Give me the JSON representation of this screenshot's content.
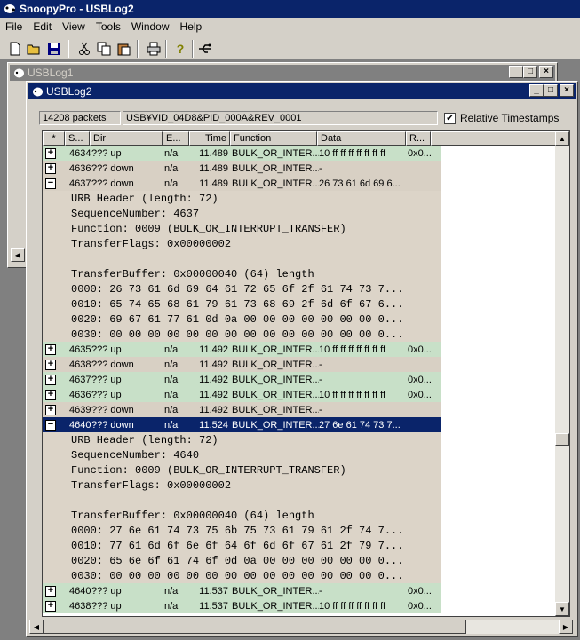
{
  "app": {
    "title": "SnoopyPro - USBLog2"
  },
  "menu": [
    "File",
    "Edit",
    "View",
    "Tools",
    "Window",
    "Help"
  ],
  "toolbar_icons": [
    "new-icon",
    "open-icon",
    "save-icon",
    "cut-icon",
    "copy-icon",
    "paste-icon",
    "print-icon",
    "help-icon",
    "usb-icon"
  ],
  "windows": {
    "back": {
      "title": "USBLog1"
    },
    "front": {
      "title": "USBLog2"
    }
  },
  "info": {
    "packets": "14208 packets",
    "device": "USB¥VID_04D8&PID_000A&REV_0001",
    "relative_label": "Relative Timestamps",
    "relative_checked": true
  },
  "columns": [
    "*",
    "S...",
    "Dir",
    "E...",
    "Time",
    "Function",
    "Data",
    "R..."
  ],
  "rows": [
    {
      "kind": "packet",
      "style": "g",
      "exp": "+",
      "s": "4634",
      "dir": "??? up",
      "e": "n/a",
      "time": "11.489",
      "func": "BULK_OR_INTER...",
      "data": "10 ff ff ff ff ff ff ff",
      "r": "0x0..."
    },
    {
      "kind": "packet",
      "style": "t",
      "exp": "+",
      "s": "4636",
      "dir": "??? down",
      "e": "n/a",
      "time": "11.489",
      "func": "BULK_OR_INTER...",
      "data": "-",
      "r": ""
    },
    {
      "kind": "packet",
      "style": "t",
      "exp": "-",
      "s": "4637",
      "dir": "??? down",
      "e": "n/a",
      "time": "11.489",
      "func": "BULK_OR_INTER...",
      "data": "26 73 61 6d 69 6...",
      "r": ""
    },
    {
      "kind": "detail",
      "text": "URB Header (length: 72)"
    },
    {
      "kind": "detail",
      "text": "SequenceNumber: 4637"
    },
    {
      "kind": "detail",
      "text": "Function: 0009 (BULK_OR_INTERRUPT_TRANSFER)"
    },
    {
      "kind": "detail",
      "text": "TransferFlags: 0x00000002"
    },
    {
      "kind": "detail",
      "text": ""
    },
    {
      "kind": "detail",
      "text": "TransferBuffer: 0x00000040 (64) length"
    },
    {
      "kind": "detail",
      "text": "0000: 26 73 61 6d 69 64 61 72 65 6f 2f 61 74 73 7..."
    },
    {
      "kind": "detail",
      "text": "0010: 65 74 65 68 61 79 61 73 68 69 2f 6d 6f 67 6..."
    },
    {
      "kind": "detail",
      "text": "0020: 69 67 61 77 61 0d 0a 00 00 00 00 00 00 00 0..."
    },
    {
      "kind": "detail",
      "text": "0030: 00 00 00 00 00 00 00 00 00 00 00 00 00 00 0..."
    },
    {
      "kind": "packet",
      "style": "g",
      "exp": "+",
      "s": "4635",
      "dir": "??? up",
      "e": "n/a",
      "time": "11.492",
      "func": "BULK_OR_INTER...",
      "data": "10 ff ff ff ff ff ff ff",
      "r": "0x0..."
    },
    {
      "kind": "packet",
      "style": "t",
      "exp": "+",
      "s": "4638",
      "dir": "??? down",
      "e": "n/a",
      "time": "11.492",
      "func": "BULK_OR_INTER...",
      "data": "-",
      "r": ""
    },
    {
      "kind": "packet",
      "style": "g",
      "exp": "+",
      "s": "4637",
      "dir": "??? up",
      "e": "n/a",
      "time": "11.492",
      "func": "BULK_OR_INTER...",
      "data": "-",
      "r": "0x0..."
    },
    {
      "kind": "packet",
      "style": "g",
      "exp": "+",
      "s": "4636",
      "dir": "??? up",
      "e": "n/a",
      "time": "11.492",
      "func": "BULK_OR_INTER...",
      "data": "10 ff ff ff ff ff ff ff",
      "r": "0x0..."
    },
    {
      "kind": "packet",
      "style": "t",
      "exp": "+",
      "s": "4639",
      "dir": "??? down",
      "e": "n/a",
      "time": "11.492",
      "func": "BULK_OR_INTER...",
      "data": "-",
      "r": ""
    },
    {
      "kind": "packet",
      "style": "s",
      "exp": "-",
      "s": "4640",
      "dir": "??? down",
      "e": "n/a",
      "time": "11.524",
      "func": "BULK_OR_INTER...",
      "data": "27 6e 61 74 73 7...",
      "r": ""
    },
    {
      "kind": "detail",
      "text": "URB Header (length: 72)"
    },
    {
      "kind": "detail",
      "text": "SequenceNumber: 4640"
    },
    {
      "kind": "detail",
      "text": "Function: 0009 (BULK_OR_INTERRUPT_TRANSFER)"
    },
    {
      "kind": "detail",
      "text": "TransferFlags: 0x00000002"
    },
    {
      "kind": "detail",
      "text": ""
    },
    {
      "kind": "detail",
      "text": "TransferBuffer: 0x00000040 (64) length"
    },
    {
      "kind": "detail",
      "text": "0000: 27 6e 61 74 73 75 6b 75 73 61 79 61 2f 74 7..."
    },
    {
      "kind": "detail",
      "text": "0010: 77 61 6d 6f 6e 6f 64 6f 6d 6f 67 61 2f 79 7..."
    },
    {
      "kind": "detail",
      "text": "0020: 65 6e 6f 61 74 6f 0d 0a 00 00 00 00 00 00 0..."
    },
    {
      "kind": "detail",
      "text": "0030: 00 00 00 00 00 00 00 00 00 00 00 00 00 00 0..."
    },
    {
      "kind": "packet",
      "style": "g",
      "exp": "+",
      "s": "4640",
      "dir": "??? up",
      "e": "n/a",
      "time": "11.537",
      "func": "BULK_OR_INTER...",
      "data": "-",
      "r": "0x0..."
    },
    {
      "kind": "packet",
      "style": "g",
      "exp": "+",
      "s": "4638",
      "dir": "??? up",
      "e": "n/a",
      "time": "11.537",
      "func": "BULK_OR_INTER...",
      "data": "10 ff ff ff ff ff ff ff",
      "r": "0x0..."
    }
  ]
}
